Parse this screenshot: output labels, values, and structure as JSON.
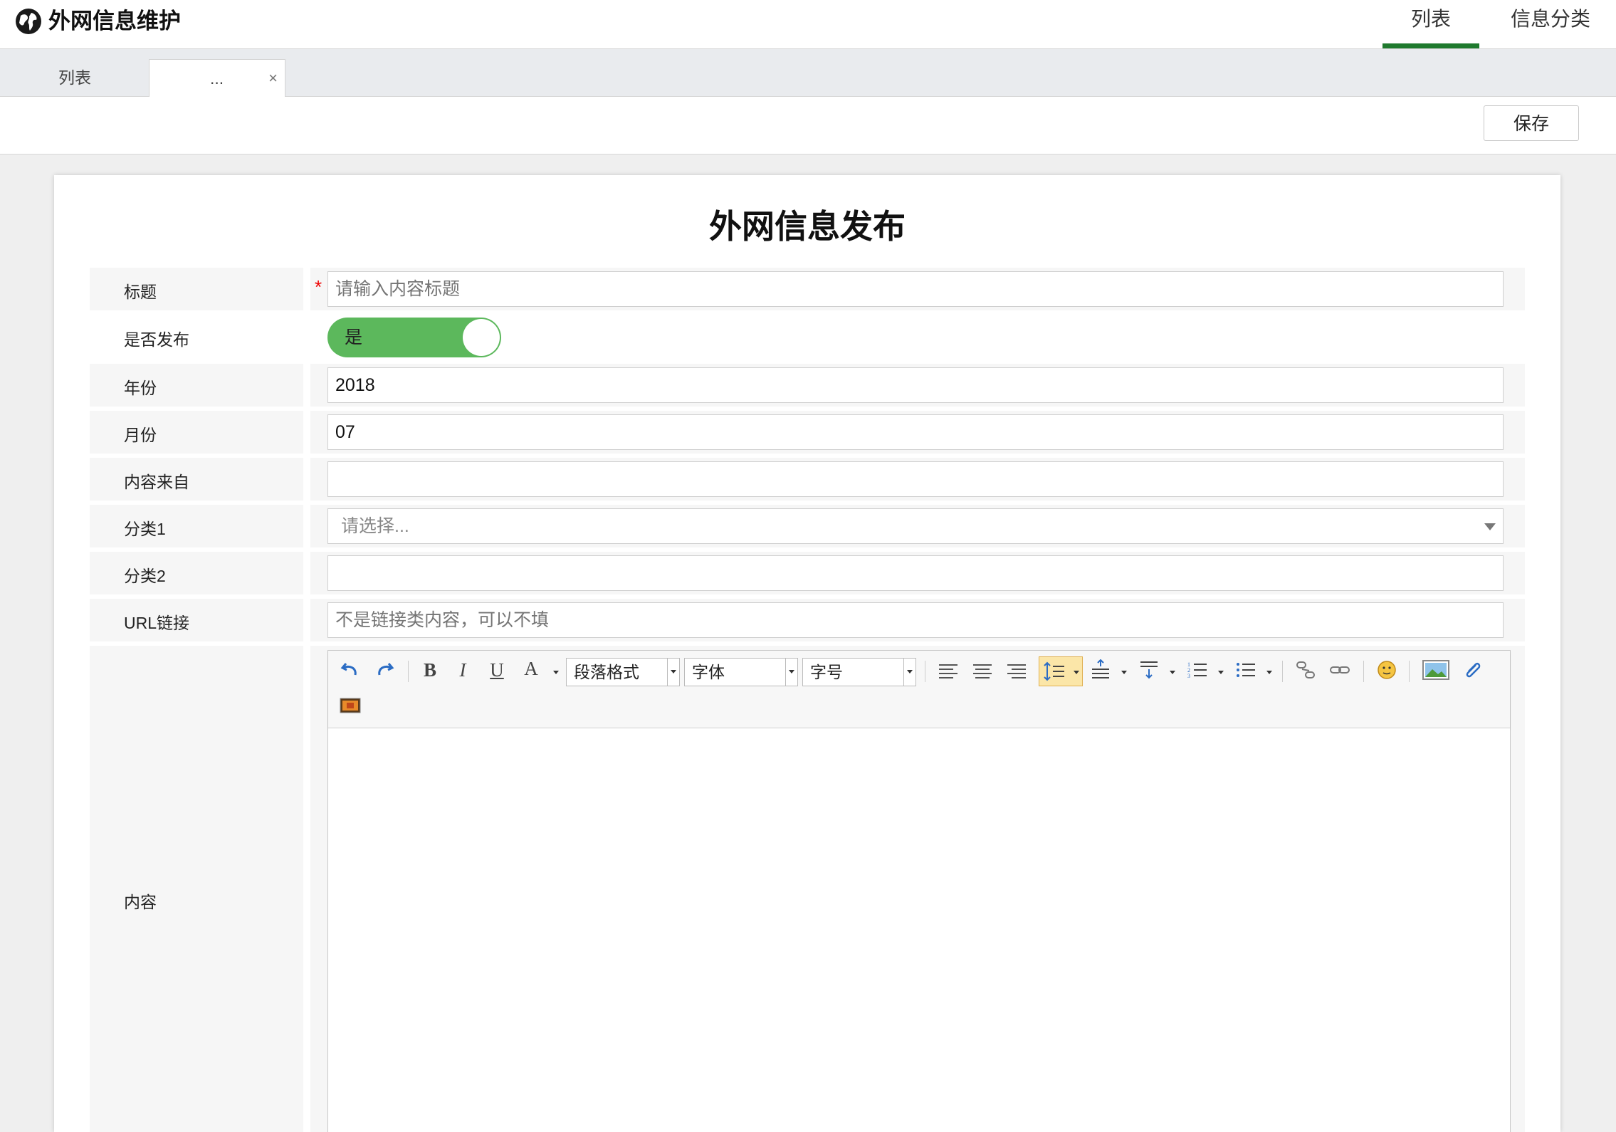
{
  "app": {
    "title": "外网信息维护"
  },
  "topnav": [
    {
      "label": "列表",
      "active": true
    },
    {
      "label": "信息分类",
      "active": false
    }
  ],
  "tabs": [
    {
      "label": "列表"
    },
    {
      "label": "...",
      "closable": true
    }
  ],
  "tab_close_glyph": "×",
  "toolbar": {
    "save_label": "保存"
  },
  "form": {
    "title": "外网信息发布",
    "required_mark": "*",
    "fields": {
      "title": {
        "label": "标题",
        "placeholder": "请输入内容标题",
        "value": ""
      },
      "publish": {
        "label": "是否发布",
        "toggle_text": "是",
        "on": true
      },
      "year": {
        "label": "年份",
        "value": "2018"
      },
      "month": {
        "label": "月份",
        "value": "07"
      },
      "source": {
        "label": "内容来自",
        "value": ""
      },
      "category1": {
        "label": "分类1",
        "placeholder": "请选择..."
      },
      "category2": {
        "label": "分类2",
        "value": ""
      },
      "url": {
        "label": "URL链接",
        "placeholder": "不是链接类内容，可以不填"
      },
      "content": {
        "label": "内容"
      }
    }
  },
  "editor": {
    "bold": "B",
    "italic": "I",
    "underline": "U",
    "fontcolor": "A",
    "paragraph": "段落格式",
    "font": "字体",
    "size": "字号",
    "icons": [
      "undo-icon",
      "redo-icon",
      "bold-icon",
      "italic-icon",
      "underline-icon",
      "font-color-icon",
      "align-left-icon",
      "align-center-icon",
      "align-right-icon",
      "line-height-icon",
      "paragraph-spacing-top-icon",
      "paragraph-spacing-bottom-icon",
      "ordered-list-icon",
      "unordered-list-icon",
      "unlink-icon",
      "link-icon",
      "emotion-icon",
      "image-icon",
      "attachment-icon",
      "video-icon"
    ]
  },
  "colors": {
    "accent": "#1f7a2e",
    "toggle": "#5cb85c",
    "required": "#ee0000"
  }
}
